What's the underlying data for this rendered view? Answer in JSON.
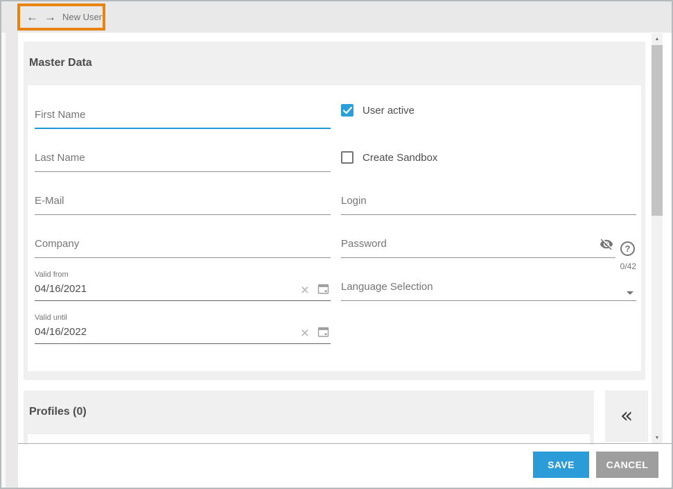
{
  "topbar": {
    "title": "New User"
  },
  "icons": {
    "back": "←",
    "forward": "→",
    "clear": "×",
    "help": "?",
    "collapse": "«",
    "scroll_up": "▲",
    "scroll_down": "▼"
  },
  "master_data": {
    "title": "Master Data",
    "first_name_placeholder": "First Name",
    "last_name_placeholder": "Last Name",
    "email_placeholder": "E-Mail",
    "company_placeholder": "Company",
    "valid_from_label": "Valid from",
    "valid_from_value": "04/16/2021",
    "valid_until_label": "Valid until",
    "valid_until_value": "04/16/2022",
    "user_active_label": "User active",
    "user_active_checked": true,
    "create_sandbox_label": "Create Sandbox",
    "create_sandbox_checked": false,
    "login_placeholder": "Login",
    "password_placeholder": "Password",
    "password_counter": "0/42",
    "language_placeholder": "Language Selection"
  },
  "profiles": {
    "title": "Profiles (0)"
  },
  "footer": {
    "save_label": "SAVE",
    "cancel_label": "CANCEL"
  },
  "colors": {
    "highlight_orange": "#E8830D",
    "accent_blue": "#2B9CD8",
    "checkbox_blue": "#29A0DA",
    "focus_underline_blue": "#1F97D4",
    "cancel_gray": "#9E9E9E",
    "section_gray": "#f0f0f0",
    "topbar_gray": "#e9e9e9"
  }
}
